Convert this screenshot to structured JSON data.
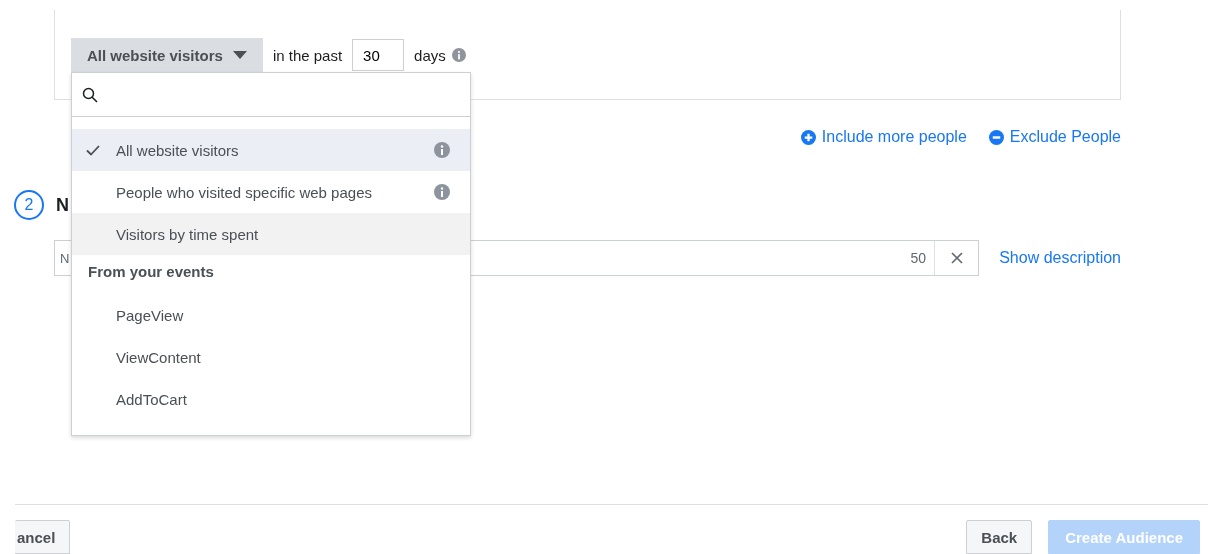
{
  "rule": {
    "audience_select": "All website visitors",
    "past_label": "in the past",
    "days_value": "30",
    "days_label": "days"
  },
  "dropdown": {
    "items": [
      {
        "kind": "option",
        "label": "All website visitors",
        "selected": true,
        "highlighted": false,
        "info": true
      },
      {
        "kind": "option",
        "label": "People who visited specific web pages",
        "selected": false,
        "highlighted": false,
        "info": true
      },
      {
        "kind": "option",
        "label": "Visitors by time spent",
        "selected": false,
        "highlighted": true,
        "info": false
      },
      {
        "kind": "header",
        "label": "From your events"
      },
      {
        "kind": "option",
        "label": "PageView",
        "selected": false,
        "highlighted": false,
        "info": false
      },
      {
        "kind": "option",
        "label": "ViewContent",
        "selected": false,
        "highlighted": false,
        "info": false
      },
      {
        "kind": "option",
        "label": "AddToCart",
        "selected": false,
        "highlighted": false,
        "info": false
      }
    ]
  },
  "links": [
    "Include more people",
    "Exclude People"
  ],
  "step": {
    "number": "2",
    "heading": "N"
  },
  "name_field": {
    "placeholder": "N",
    "counter": "50"
  },
  "show_description": "Show description",
  "footer": {
    "cancel": "ancel",
    "back": "Back",
    "create": {
      "label": "Create Audience",
      "disabled": true
    }
  }
}
